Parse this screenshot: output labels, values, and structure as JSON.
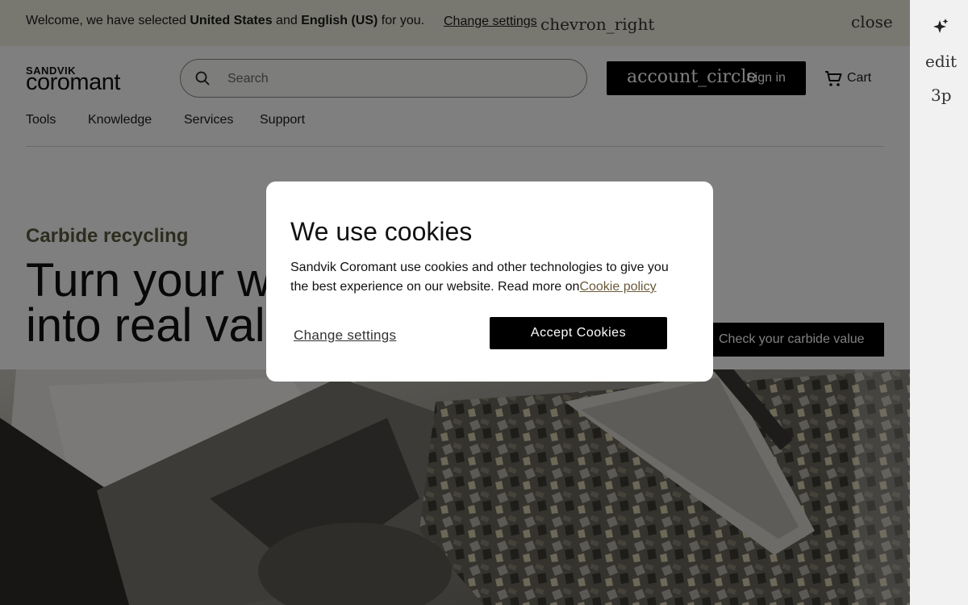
{
  "locale_bar": {
    "prefix": "Welcome, we have selected ",
    "country": "United States",
    "middle": " and ",
    "language": "English (US)",
    "suffix": " for you.",
    "change_settings": "Change settings",
    "chevron_icon": "chevron_right",
    "close_icon": "close"
  },
  "header": {
    "logo_top": "SANDVIK",
    "logo_main": "coromant",
    "search_placeholder": "Search",
    "signin_icon": "account_circle",
    "signin_label": "Sign in",
    "cart_label": "Cart"
  },
  "nav": {
    "items": [
      "Tools",
      "Knowledge",
      "Services",
      "Support"
    ]
  },
  "hero": {
    "eyebrow": "Carbide recycling",
    "headline_line1": "Turn your worn tools",
    "headline_line2": "into real value",
    "cta_label": "Check your carbide value"
  },
  "side_rail": {
    "edit_label": "edit",
    "threep_label": "3p"
  },
  "cookie_modal": {
    "title": "We use cookies",
    "body": "Sandvik Coromant use cookies and other technologies to give you the best experience on our website. Read more on",
    "link": "Cookie policy",
    "change_settings": "Change settings",
    "accept": "Accept Cookies"
  },
  "colors": {
    "accent": "#000000",
    "locale_bar_bg": "#f1f0e1",
    "eyebrow": "#5a5a3e",
    "overlay": "rgba(0,0,0,0.5)"
  }
}
